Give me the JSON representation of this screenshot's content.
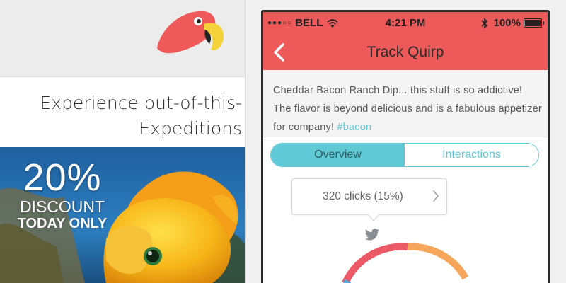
{
  "left_screen": {
    "logo_icon": "parrot-logo",
    "headline_line1": "Experience out-of-this-",
    "headline_line2": "Expeditions",
    "promo": {
      "percent": "20%",
      "label": "DISCOUNT",
      "sublabel": "TODAY ONLY"
    },
    "banner_image": "goldfish-underwater-photo"
  },
  "status_bar": {
    "signal_dots": "●●●○○",
    "carrier": "BELL",
    "wifi_icon": "wifi-icon",
    "time": "4:21 PM",
    "bluetooth_icon": "bluetooth-icon",
    "battery_text": "100%",
    "battery_level": 1.0
  },
  "nav": {
    "back_icon": "chevron-left-icon",
    "title": "Track Quirp"
  },
  "post": {
    "text": "Cheddar Bacon Ranch Dip... this stuff is so addictive! The flavor is beyond delicious and is a fabulous appetizer for company!",
    "hashtag": "#bacon"
  },
  "tabs": [
    {
      "label": "Overview",
      "active": true
    },
    {
      "label": "Interactions",
      "active": false
    }
  ],
  "tooltip": {
    "text": "320 clicks (15%)",
    "chevron_icon": "chevron-right-icon"
  },
  "chart_icon": "twitter-icon",
  "colors": {
    "accent_red": "#ee5a5a",
    "accent_teal": "#5fc9d6",
    "chart_red": "#ec5a67",
    "chart_orange": "#f5a65b",
    "chart_blue": "#5aaee0"
  }
}
